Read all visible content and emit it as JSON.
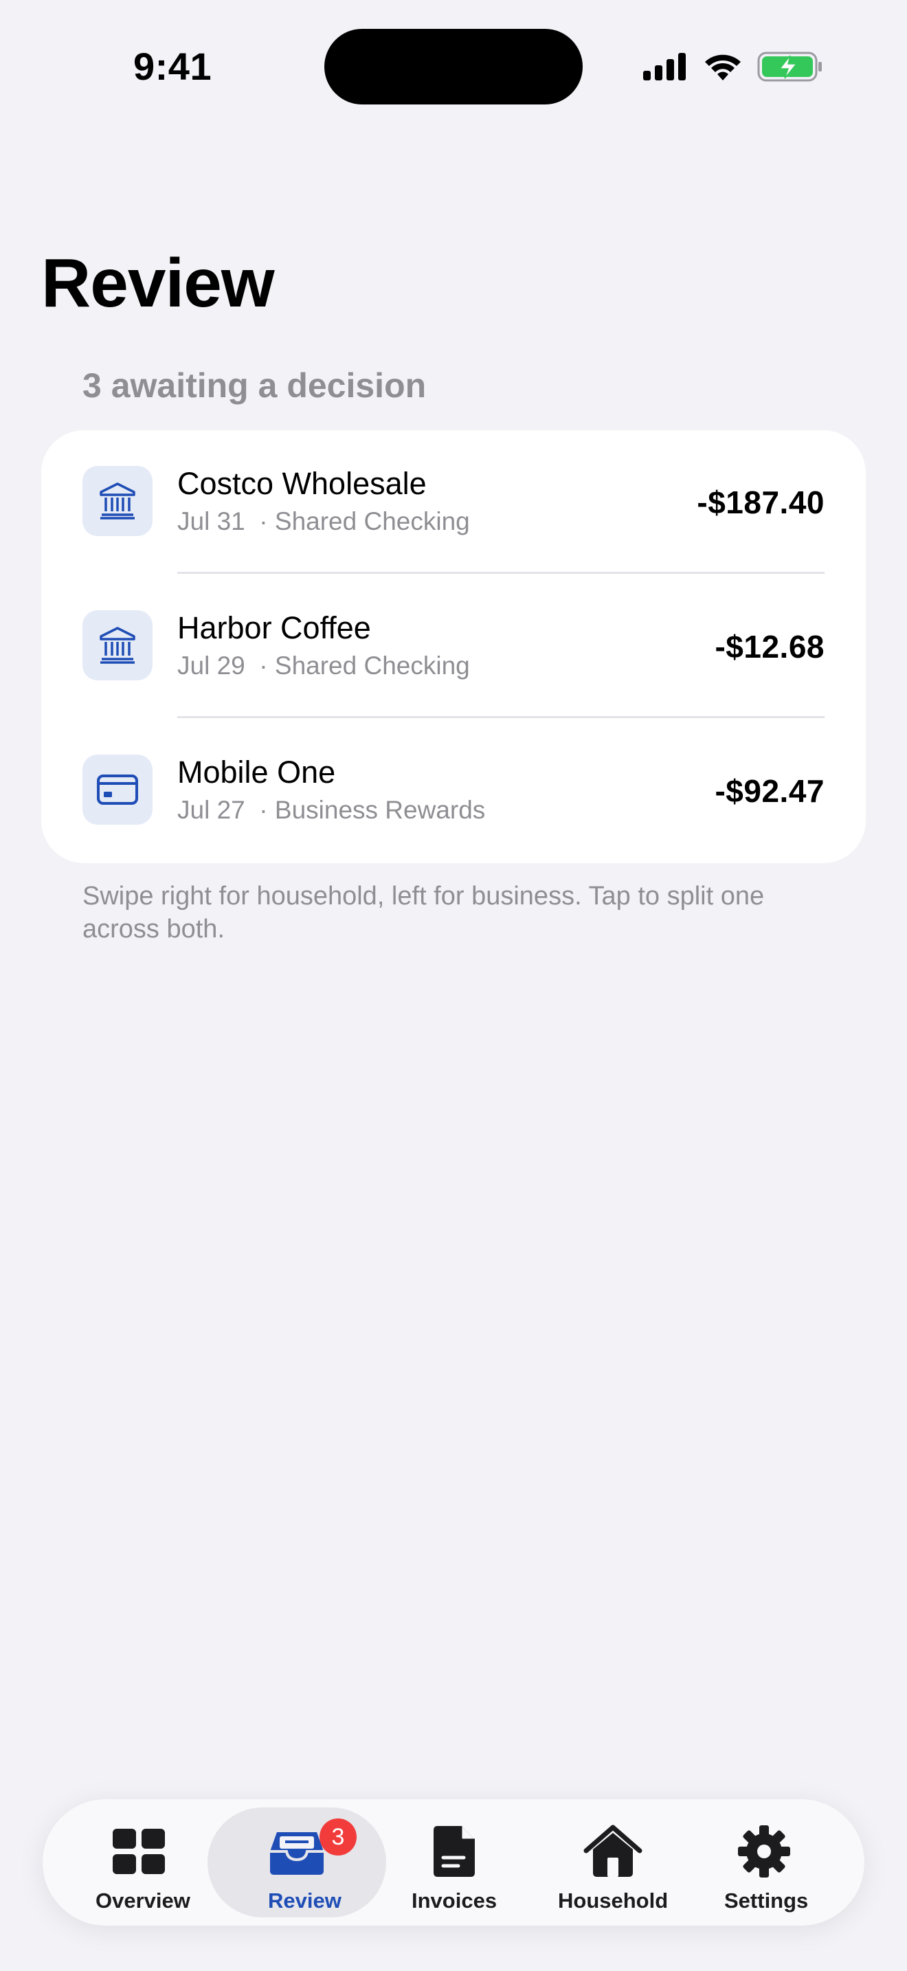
{
  "status_bar": {
    "time": "9:41"
  },
  "page": {
    "title": "Review",
    "subtitle": "3 awaiting a decision",
    "hint": "Swipe right for household, left for business. Tap to split one across both."
  },
  "transactions": [
    {
      "name": "Costco Wholesale",
      "meta": "Jul 31  · Shared Checking",
      "amount": "-$187.40",
      "icon": "bank-icon"
    },
    {
      "name": "Harbor Coffee",
      "meta": "Jul 29  · Shared Checking",
      "amount": "-$12.68",
      "icon": "bank-icon"
    },
    {
      "name": "Mobile One",
      "meta": "Jul 27  · Business Rewards",
      "amount": "-$92.47",
      "icon": "credit-card-icon"
    }
  ],
  "tab_bar": {
    "tabs": [
      {
        "label": "Overview",
        "icon": "grid-icon"
      },
      {
        "label": "Review",
        "icon": "inbox-tray-icon",
        "badge": "3",
        "active": true
      },
      {
        "label": "Invoices",
        "icon": "document-icon"
      },
      {
        "label": "Household",
        "icon": "house-icon"
      },
      {
        "label": "Settings",
        "icon": "gear-icon"
      }
    ]
  },
  "colors": {
    "accent": "#1F4DB6",
    "icon_tile": "#E4EAF6",
    "badge": "#F23C3C",
    "battery": "#34C759",
    "background": "#F2F2F7"
  }
}
